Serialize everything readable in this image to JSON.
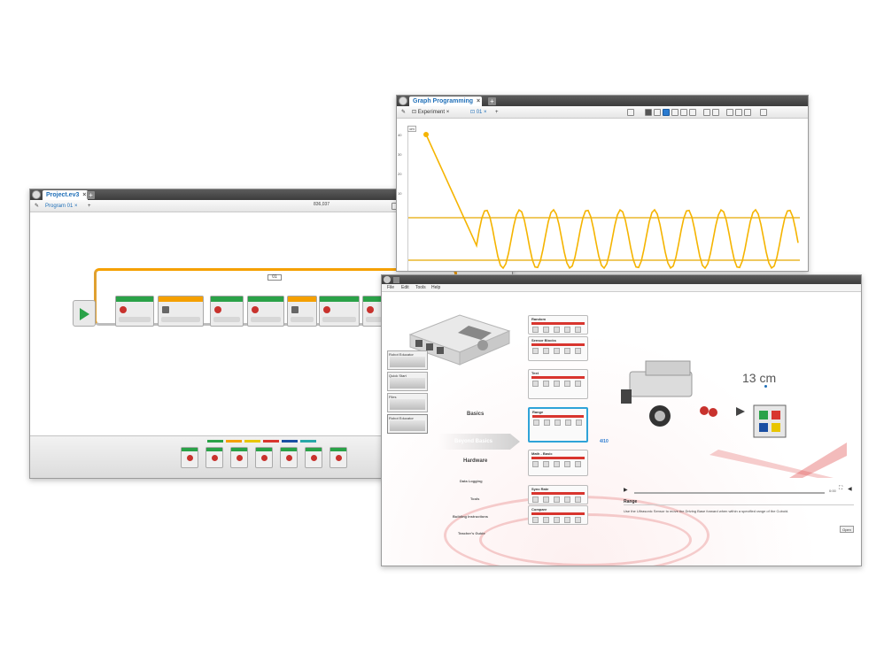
{
  "program_window": {
    "tab_title": "Project.ev3",
    "program_tab": "Program 01",
    "coordinates": "836,037",
    "loop_label": "01",
    "blocks": [
      {
        "band": "#2aa248",
        "icon": "motor"
      },
      {
        "band": "#f5a000",
        "icon": "sound"
      },
      {
        "band": "#2aa248",
        "icon": "motor"
      },
      {
        "band": "#2aa248",
        "icon": "motor"
      },
      {
        "band": "#f5a000",
        "icon": "wait"
      },
      {
        "band": "#2aa248",
        "icon": "motor"
      },
      {
        "band": "#2aa248",
        "icon": "motor"
      }
    ],
    "palette_colors": [
      "#2aa248",
      "#f5a000",
      "#e8c500",
      "#d8352e",
      "#1a4fa3",
      "#28a8a8"
    ]
  },
  "graph_window": {
    "tab_title": "Graph Programming",
    "experiment_tab": "Experiment",
    "sub_tab": "01",
    "unit": "cm",
    "y_ticks": [
      "40",
      "30",
      "20",
      "10"
    ],
    "accent": "#f5b400"
  },
  "lobby_window": {
    "menu": [
      "File",
      "Edit",
      "Tools",
      "Help"
    ],
    "thumbnails": [
      "Robot Educator",
      "Quick Start",
      "Files",
      "Robot Educator"
    ],
    "categories": [
      "Basics",
      "Beyond Basics",
      "Hardware",
      "Data Logging",
      "Tools",
      "Building Instructions",
      "Teacher's Guide"
    ],
    "lessons": [
      "Random",
      "Sensor Blocks",
      "Text",
      "Range",
      "Math - Basic",
      "Sync Rate",
      "Compare"
    ],
    "pager": "4/10",
    "distance": "13 cm",
    "video_time": "0:00",
    "description_title": "Range",
    "description": "Use the Ultrasonic Sensor to move the Driving Base forward when within a specified range of the Cuboid.",
    "open_label": "Open"
  }
}
